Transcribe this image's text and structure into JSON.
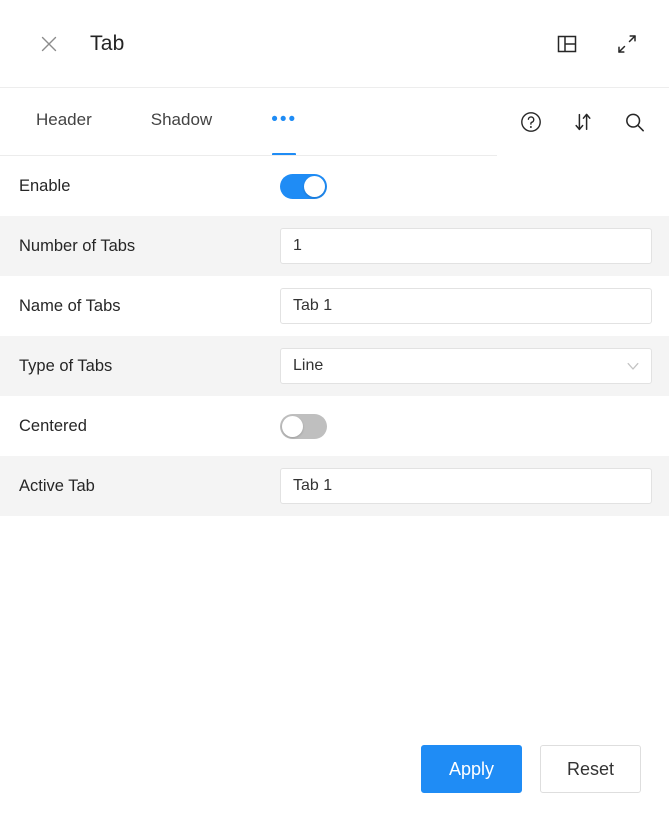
{
  "titlebar": {
    "title": "Tab",
    "close_label": "close-icon",
    "actions": [
      {
        "name": "panel-layout-icon",
        "label": "Panel layout"
      },
      {
        "name": "expand-icon",
        "label": "Expand"
      }
    ]
  },
  "tabbar": {
    "tabs": [
      {
        "label": "Header",
        "active": false
      },
      {
        "label": "Shadow",
        "active": false
      },
      {
        "label": "•••",
        "active": true
      }
    ],
    "actions": [
      {
        "name": "help-icon",
        "label": "Help"
      },
      {
        "name": "sort-icon",
        "label": "Sort"
      },
      {
        "name": "search-icon",
        "label": "Search"
      }
    ]
  },
  "form": {
    "rows": [
      {
        "label": "Enable",
        "type": "toggle",
        "value": "on",
        "alt": false
      },
      {
        "label": "Number of Tabs",
        "type": "text",
        "value": "1",
        "placeholder": "",
        "alt": true
      },
      {
        "label": "Name of Tabs",
        "type": "text",
        "value": "Tab 1",
        "placeholder": "",
        "alt": false
      },
      {
        "label": "Type of Tabs",
        "type": "select",
        "value": "Line",
        "alt": true
      },
      {
        "label": "Centered",
        "type": "toggle",
        "value": "off",
        "alt": false
      },
      {
        "label": "Active Tab",
        "type": "text",
        "value": "Tab 1",
        "placeholder": "",
        "alt": true
      }
    ]
  },
  "footer": {
    "apply_label": "Apply",
    "reset_label": "Reset"
  },
  "colors": {
    "accent": "#1f8cf5",
    "row_alt": "#f4f4f4",
    "toggle_off": "#bfbfbf",
    "border": "#e2e2e2"
  }
}
